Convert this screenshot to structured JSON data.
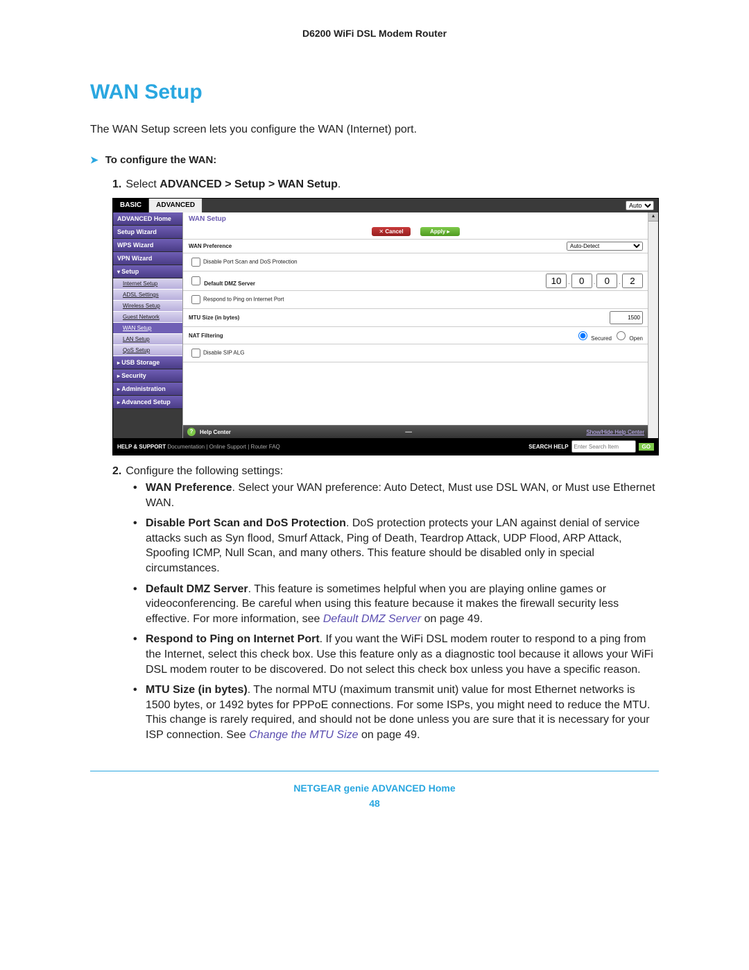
{
  "header": {
    "device": "D6200 WiFi DSL Modem Router"
  },
  "title": "WAN Setup",
  "intro": "The WAN Setup screen lets you configure the WAN (Internet) port.",
  "config_heading": "To configure the WAN:",
  "steps": {
    "s1_prefix": "Select ",
    "s1_bold": "ADVANCED > Setup > WAN Setup",
    "s1_suffix": ".",
    "s2": "Configure the following settings:"
  },
  "screenshot": {
    "tabs": {
      "basic": "BASIC",
      "advanced": "ADVANCED",
      "auto": "Auto"
    },
    "sidebar": {
      "home": "ADVANCED Home",
      "setup_wizard": "Setup Wizard",
      "wps_wizard": "WPS Wizard",
      "vpn_wizard": "VPN Wizard",
      "setup": "Setup",
      "subs": {
        "internet": "Internet Setup",
        "adsl": "ADSL Settings",
        "wireless": "Wireless Setup",
        "guest": "Guest Network",
        "wan": "WAN Setup",
        "lan": "LAN Setup",
        "qos": "QoS Setup"
      },
      "usb": "USB Storage",
      "security": "Security",
      "admin": "Administration",
      "adv": "Advanced Setup"
    },
    "main": {
      "title": "WAN Setup",
      "cancel": "Cancel",
      "apply": "Apply",
      "rows": {
        "wan_pref": "WAN Preference",
        "wan_pref_val": "Auto-Detect",
        "disable_port": "Disable Port Scan and DoS Protection",
        "dmz": "Default DMZ Server",
        "dmz_ip": {
          "a": "10",
          "b": "0",
          "c": "0",
          "d": "2"
        },
        "ping": "Respond to Ping on Internet Port",
        "mtu": "MTU Size (in bytes)",
        "mtu_val": "1500",
        "nat": "NAT Filtering",
        "nat_secured": "Secured",
        "nat_open": "Open",
        "sip": "Disable SIP ALG"
      },
      "help": {
        "label": "Help Center",
        "link": "Show/Hide Help Center"
      },
      "footer": {
        "left_bold": "HELP & SUPPORT",
        "left_rest": "  Documentation  |  Online Support  |  Router FAQ",
        "search_label": "SEARCH HELP",
        "search_ph": "Enter Search Item",
        "go": "GO"
      }
    }
  },
  "bullets": {
    "b1_bold": "WAN Preference",
    "b1_rest": ". Select your WAN preference: Auto Detect, Must use DSL WAN, or Must use Ethernet WAN.",
    "b2_bold": "Disable Port Scan and DoS Protection",
    "b2_rest": ". DoS protection protects your LAN against denial of service attacks such as Syn flood, Smurf Attack, Ping of Death, Teardrop Attack, UDP Flood, ARP Attack, Spoofing ICMP, Null Scan, and many others. This feature should be disabled only in special circumstances.",
    "b3_bold": "Default DMZ Server",
    "b3_rest_a": ". This feature is sometimes helpful when you are playing online games or videoconferencing. Be careful when using this feature because it makes the firewall security less effective. For more information, see ",
    "b3_link": "Default DMZ Server",
    "b3_rest_b": " on page 49.",
    "b4_bold": "Respond to Ping on Internet Port",
    "b4_rest": ". If you want the WiFi DSL modem router to respond to a ping from the Internet, select this check box. Use this feature only as a diagnostic tool because it allows your WiFi DSL modem router to be discovered. Do not select this check box unless you have a specific reason.",
    "b5_bold": "MTU Size (in bytes)",
    "b5_rest_a": ". The normal MTU (maximum transmit unit) value for most Ethernet networks is 1500 bytes, or 1492 bytes for PPPoE connections. For some ISPs, you might need to reduce the MTU. This change is rarely required, and should not be done unless you are sure that it is necessary for your ISP connection. See ",
    "b5_link": "Change the MTU Size",
    "b5_rest_b": " on page 49."
  },
  "footer": {
    "line1": "NETGEAR genie ADVANCED Home",
    "page": "48"
  }
}
